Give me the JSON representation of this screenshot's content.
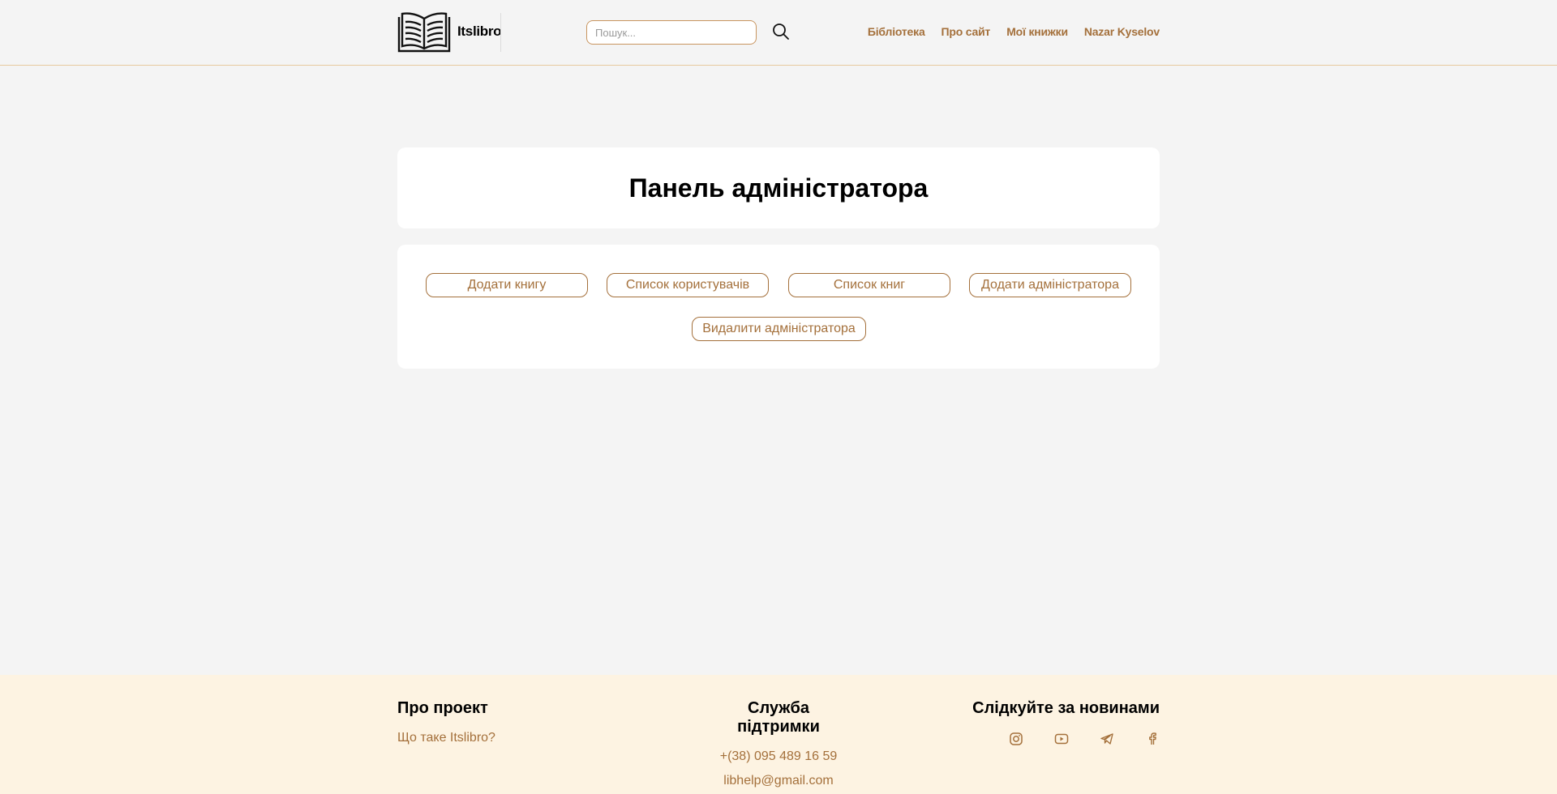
{
  "header": {
    "brand": "Itslibro",
    "search_placeholder": "Пошук...",
    "nav": [
      "Бібліотека",
      "Про сайт",
      "Мої книжки",
      "Nazar Kyselov"
    ]
  },
  "main": {
    "title": "Панель адміністратора",
    "actions": [
      "Додати книгу",
      "Список користувачів",
      "Список книг",
      "Додати адміністратора",
      "Видалити адміністратора"
    ]
  },
  "footer": {
    "about_title": "Про проект",
    "about_link": "Що таке Itslibro?",
    "support_title": "Служба підтримки",
    "phone": "+(38) 095 489 16 59",
    "email": "libhelp@gmail.com",
    "news_title": "Слідкуйте за новинами",
    "socials": [
      "instagram-icon",
      "youtube-icon",
      "telegram-icon",
      "facebook-icon"
    ]
  },
  "colors": {
    "accent": "#a4703b",
    "footer_bg": "#fdf3e2",
    "page_bg": "#f4f4f4"
  }
}
